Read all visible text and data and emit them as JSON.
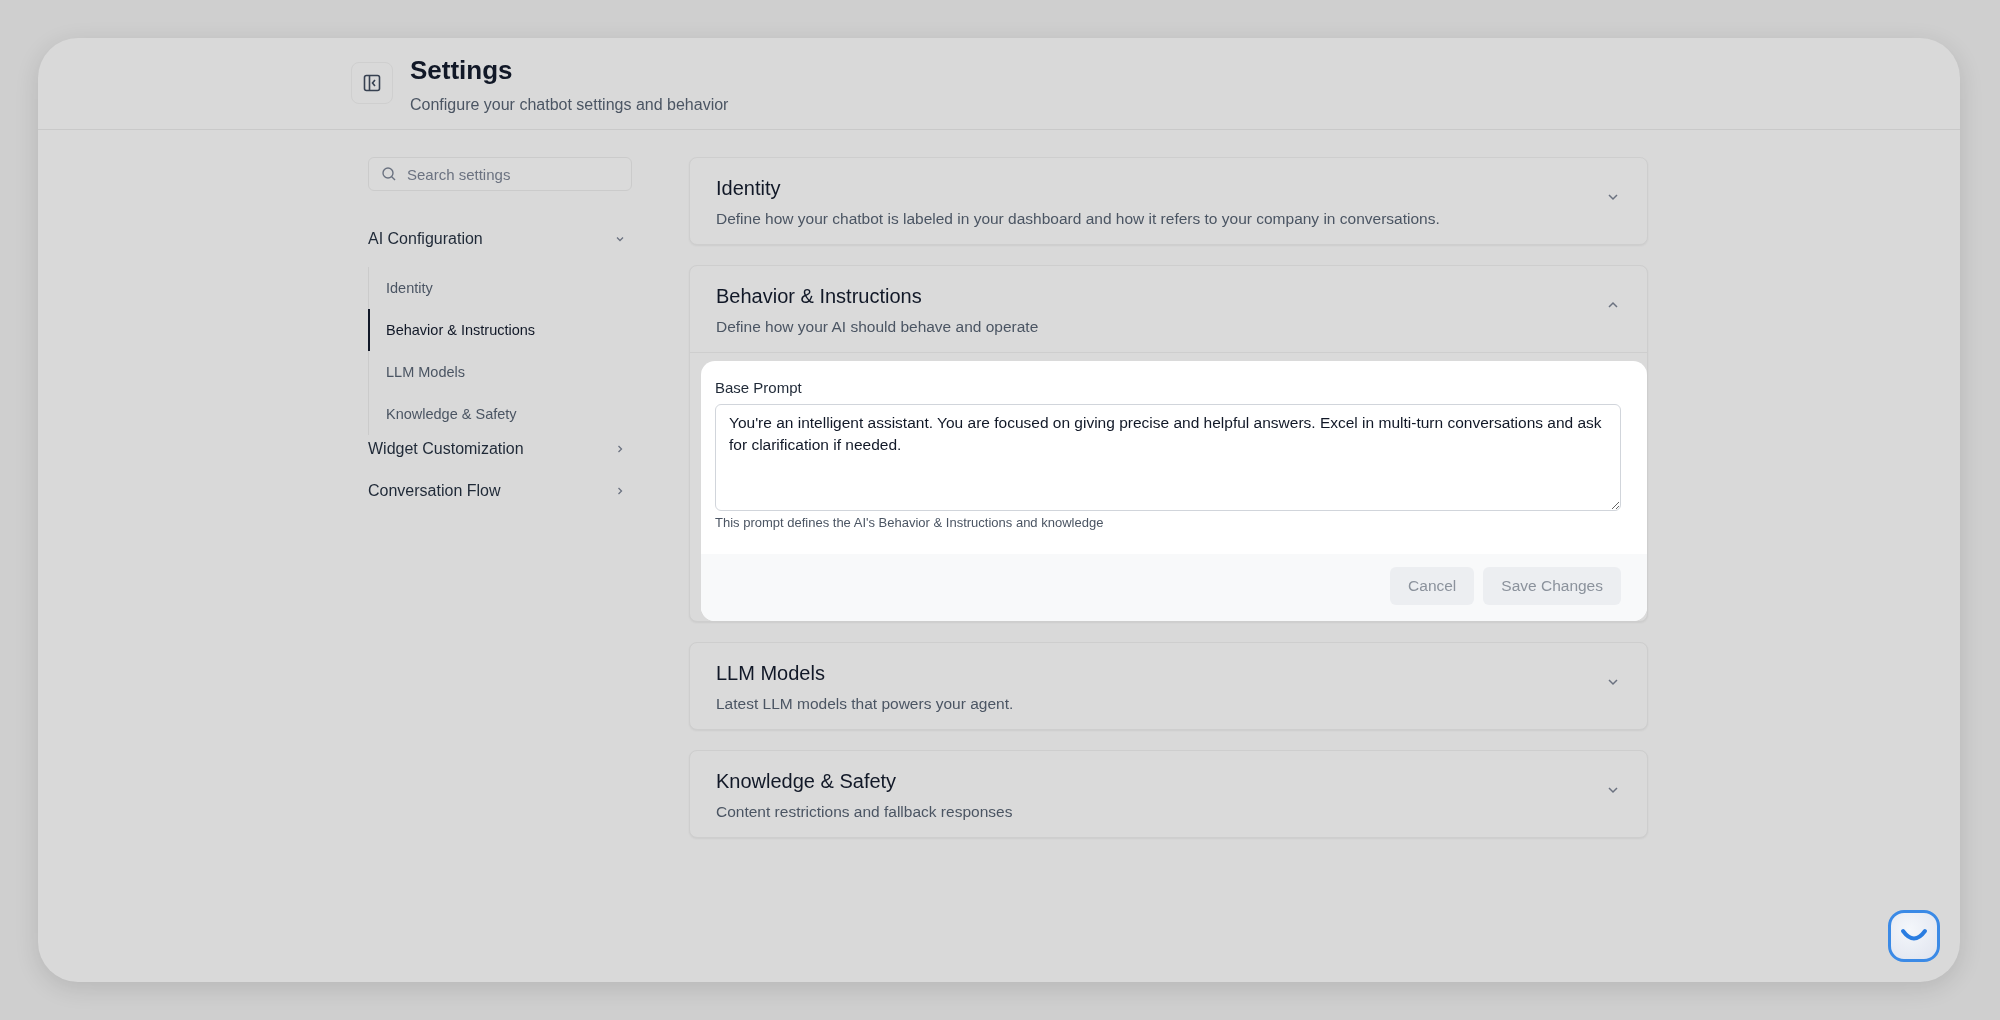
{
  "header": {
    "title": "Settings",
    "subtitle": "Configure your chatbot settings and behavior"
  },
  "search": {
    "placeholder": "Search settings"
  },
  "sidebar": [
    {
      "label": "AI Configuration",
      "expanded": true,
      "children": [
        {
          "label": "Identity",
          "selected": false
        },
        {
          "label": "Behavior & Instructions",
          "selected": true
        },
        {
          "label": "LLM Models",
          "selected": false
        },
        {
          "label": "Knowledge & Safety",
          "selected": false
        }
      ]
    },
    {
      "label": "Widget Customization",
      "expanded": false
    },
    {
      "label": "Conversation Flow",
      "expanded": false
    }
  ],
  "sections": [
    {
      "title": "Identity",
      "description": "Define how your chatbot is labeled in your dashboard and how it refers to your company in conversations.",
      "expanded": false
    },
    {
      "title": "Behavior & Instructions",
      "description": "Define how your AI should behave and operate",
      "expanded": true,
      "field": {
        "label": "Base Prompt",
        "value": "You're an intelligent assistant. You are focused on giving precise and helpful answers. Excel in multi-turn conversations and ask for clarification if needed.",
        "help": "This prompt defines the AI's Behavior & Instructions and knowledge"
      },
      "buttons": [
        {
          "label": "Cancel",
          "disabled": true
        },
        {
          "label": "Save Changes",
          "disabled": true
        }
      ]
    },
    {
      "title": "LLM Models",
      "description": "Latest LLM models that powers your agent.",
      "expanded": false
    },
    {
      "title": "Knowledge & Safety",
      "description": "Content restrictions and fallback responses",
      "expanded": false
    }
  ]
}
